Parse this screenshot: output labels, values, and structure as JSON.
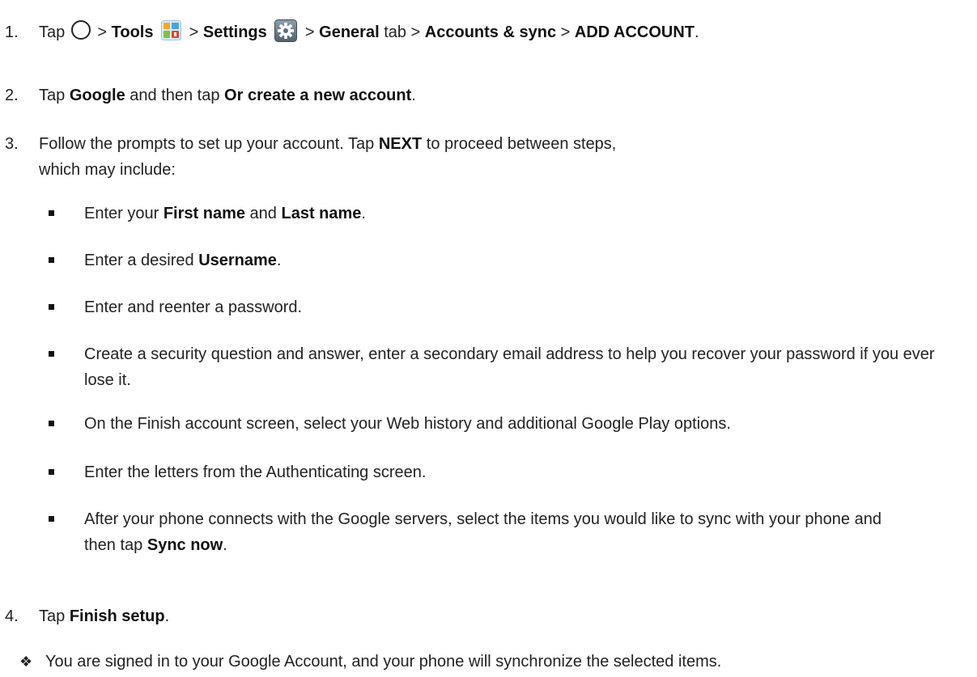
{
  "steps": [
    {
      "num": "1.",
      "t1": "Tap",
      "t2": ">",
      "tools": "Tools",
      "t3": ">",
      "settings": "Settings",
      "t4": ">",
      "general": "General",
      "t5": "tab >",
      "accounts": "Accounts & sync",
      "t6": ">",
      "add": "ADD ACCOUNT",
      "t7": ".",
      "icons": [
        "home-circle-icon",
        "tools-folder-icon",
        "settings-gear-icon"
      ]
    },
    {
      "num": "2.",
      "t1": "Tap",
      "google": "Google",
      "t2": "and then tap",
      "create": "Or create a new account",
      "t3": "."
    },
    {
      "num": "3.",
      "t1": "Follow the prompts to set up your account. Tap",
      "next": "NEXT",
      "t2": "to proceed between steps, which may include:"
    },
    {
      "num": "4.",
      "t1": "Tap",
      "finish": "Finish setup",
      "t2": "."
    }
  ],
  "bullets": [
    {
      "a": "Enter your",
      "b1": "First name",
      "c": "and",
      "b2": "Last name",
      "d": "."
    },
    {
      "a": "Enter a desired",
      "b1": "Username",
      "d": "."
    },
    {
      "a": "Enter and reenter a password."
    },
    {
      "a": "Create a security question and answer, enter a secondary email address to help you recover your password if you ever lose it."
    },
    {
      "a": "On the Finish account screen, select your Web history and additional Google Play options."
    },
    {
      "a": "Enter the letters from the Authenticating screen."
    },
    {
      "a": "After your phone connects with the Google servers, select the items you would like to sync with your phone and then tap",
      "b1": "Sync now",
      "d": "."
    }
  ],
  "note": {
    "mark": "❖",
    "text": "You are signed in to your Google Account, and your phone will synchronize the selected items."
  }
}
